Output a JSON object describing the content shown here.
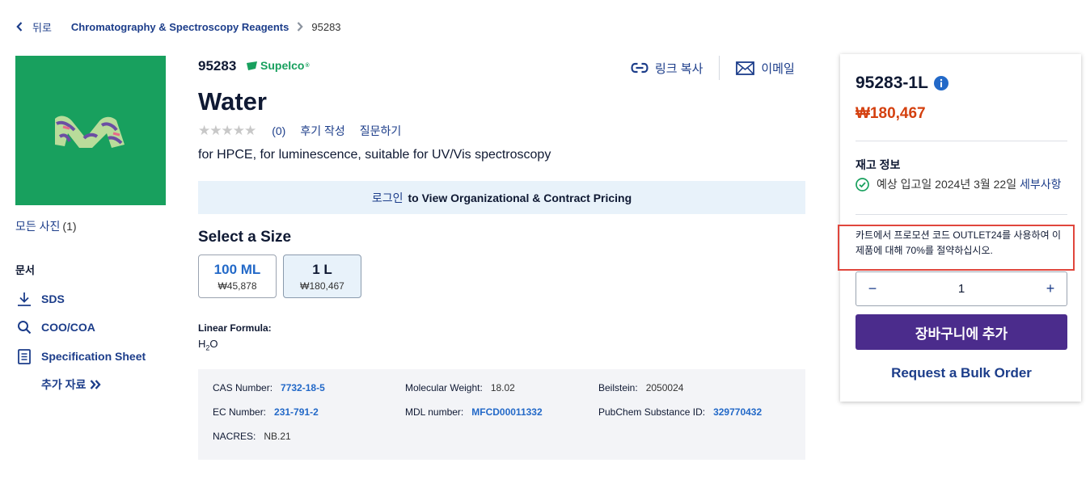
{
  "breadcrumb": {
    "back_label": "뒤로",
    "category": "Chromatography & Spectroscopy Reagents",
    "current": "95283"
  },
  "gallery": {
    "all_photos_label": "모든 사진",
    "photo_count": "(1)"
  },
  "documents": {
    "title": "문서",
    "items": [
      {
        "label": "SDS",
        "icon": "download-icon"
      },
      {
        "label": "COO/COA",
        "icon": "search-icon"
      },
      {
        "label": "Specification Sheet",
        "icon": "document-icon"
      }
    ],
    "more_label": "추가 자료"
  },
  "product": {
    "sku": "95283",
    "brand": "Supelco",
    "brand_mark": "®",
    "name": "Water",
    "rating_stars": 0,
    "rating_count": "(0)",
    "write_review_label": "후기 작성",
    "ask_question_label": "질문하기",
    "description": "for HPCE, for luminescence, suitable for UV/Vis spectroscopy",
    "brand_color": "#18a05e"
  },
  "actions": {
    "copy_link_label": "링크 복사",
    "email_label": "이메일"
  },
  "login_banner": {
    "login_label": "로그인",
    "rest_label": "to View Organizational & Contract Pricing"
  },
  "sizes": {
    "title": "Select a Size",
    "options": [
      {
        "size": "100 ML",
        "price": "₩45,878",
        "selected": false
      },
      {
        "size": "1 L",
        "price": "₩180,467",
        "selected": true
      }
    ]
  },
  "formula": {
    "label": "Linear Formula:",
    "part1": "H",
    "subscript": "2",
    "part2": "O"
  },
  "properties": {
    "cas": {
      "key": "CAS Number:",
      "value": "7732-18-5"
    },
    "mw": {
      "key": "Molecular Weight:",
      "value": "18.02"
    },
    "beilstein": {
      "key": "Beilstein:",
      "value": "2050024"
    },
    "ec": {
      "key": "EC Number:",
      "value": "231-791-2"
    },
    "mdl": {
      "key": "MDL number:",
      "value": "MFCD00011332"
    },
    "pubchem": {
      "key": "PubChem Substance ID:",
      "value": "329770432"
    },
    "nacres": {
      "key": "NACRES:",
      "value": "NB.21"
    }
  },
  "purchase": {
    "sku": "95283-1L",
    "price": "₩180,467",
    "price_color": "#d4400f",
    "stock_title": "재고 정보",
    "stock_text": "예상 입고일 2024년 3월 22일 ",
    "stock_details_label": "세부사항",
    "promo_text": "카트에서 프로모션 코드 OUTLET24를 사용하여 이 제품에 대해 70%를 절약하십시오.",
    "quantity": "1",
    "add_to_cart_label": "장바구니에 추가",
    "add_to_cart_color": "#4b2c8c",
    "bulk_order_label": "Request a Bulk Order"
  }
}
